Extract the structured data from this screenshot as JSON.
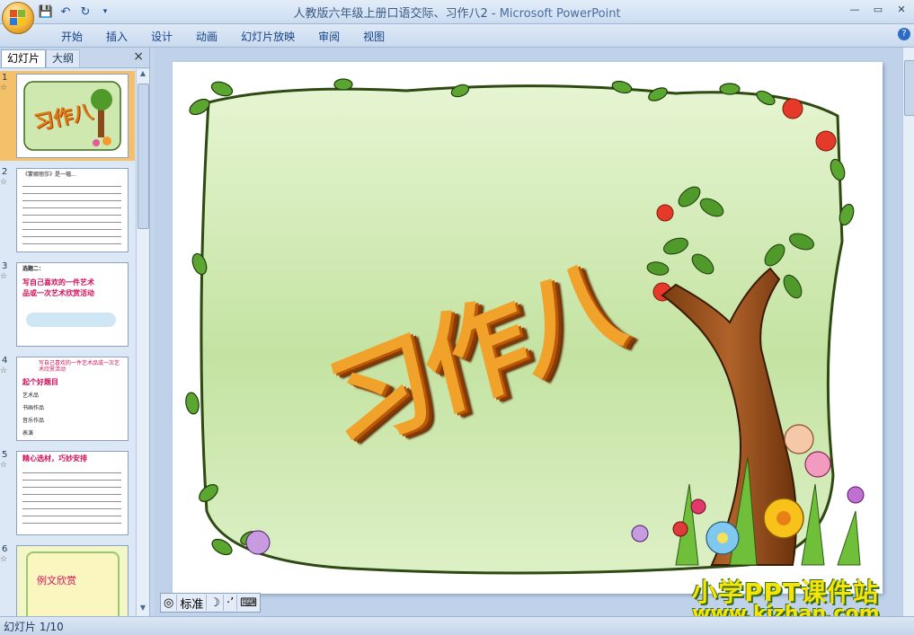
{
  "window": {
    "title": "人教版六年级上册口语交际、习作八2 -",
    "app_name": "Microsoft PowerPoint"
  },
  "quick_access": [
    "save-icon",
    "undo-icon",
    "redo-icon",
    "customize-icon"
  ],
  "ribbon": {
    "tabs": [
      "开始",
      "插入",
      "设计",
      "动画",
      "幻灯片放映",
      "审阅",
      "视图"
    ]
  },
  "panel": {
    "tab_slides": "幻灯片",
    "tab_outline": "大纲",
    "close": "×",
    "thumbs": [
      {
        "num": "1",
        "text": "习作八"
      },
      {
        "num": "2",
        "text": "《蒙娜丽莎》是一幅…"
      },
      {
        "num": "3",
        "text": "选题二："
      },
      {
        "num": "4",
        "text": "起个好题目"
      },
      {
        "num": "5",
        "text": "精心选材，巧妙安排"
      },
      {
        "num": "6",
        "text": "例文欣赏"
      }
    ],
    "thumb_lines": {
      "t3_a": "写自己喜欢的一件艺术",
      "t3_b": "品或一次艺术欣赏活动",
      "t4_head": "写自己喜欢的一件艺术品或一次艺术欣赏活动",
      "t4_items": [
        "艺术品",
        "书画作品",
        "音乐作品",
        "表演",
        "……"
      ]
    }
  },
  "slide": {
    "title": "习作八"
  },
  "view_bar": {
    "lang": "标准",
    "icons": [
      "ime-icon",
      "moon-icon",
      "punctuation-icon",
      "keyboard-icon"
    ]
  },
  "status": {
    "slide_info": "幻灯片 1/10"
  },
  "watermark": {
    "line1": "小学PPT课件站",
    "line2": "www.kjzhan.com"
  },
  "colors": {
    "ribbon_text": "#15428b",
    "selected_thumb": "#f5c06a",
    "slide_green": "#c9e6a8",
    "title_orange": "#e8861a"
  }
}
